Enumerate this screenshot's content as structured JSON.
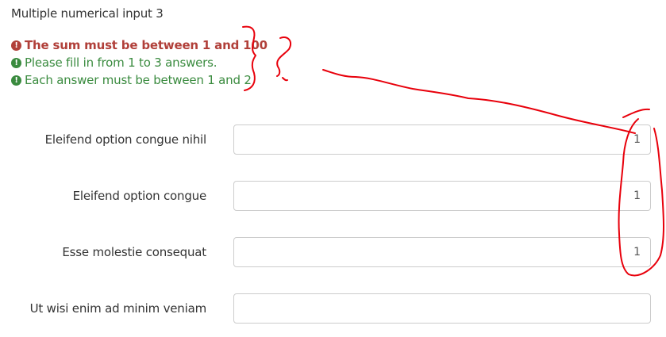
{
  "question": {
    "title": "Multiple numerical input 3"
  },
  "validation": {
    "tips": [
      {
        "text": "The sum must be between 1 and 100",
        "status": "error",
        "icon": "exclamation-circle-icon"
      },
      {
        "text": "Please fill in from 1 to 3 answers.",
        "status": "ok",
        "icon": "exclamation-circle-icon"
      },
      {
        "text": "Each answer must be between 1 and 2",
        "status": "ok",
        "icon": "exclamation-circle-icon"
      }
    ],
    "icon_glyph": "!"
  },
  "answers": [
    {
      "label": "Eleifend option congue nihil",
      "value": "1"
    },
    {
      "label": "Eleifend option congue",
      "value": "1"
    },
    {
      "label": "Esse molestie consequat",
      "value": "1"
    },
    {
      "label": "Ut wisi enim ad minim veniam",
      "value": ""
    }
  ],
  "colors": {
    "error": "#b1403a",
    "ok": "#3a8b3f",
    "annotation": "#e8000b",
    "input_border": "#cccccc"
  }
}
